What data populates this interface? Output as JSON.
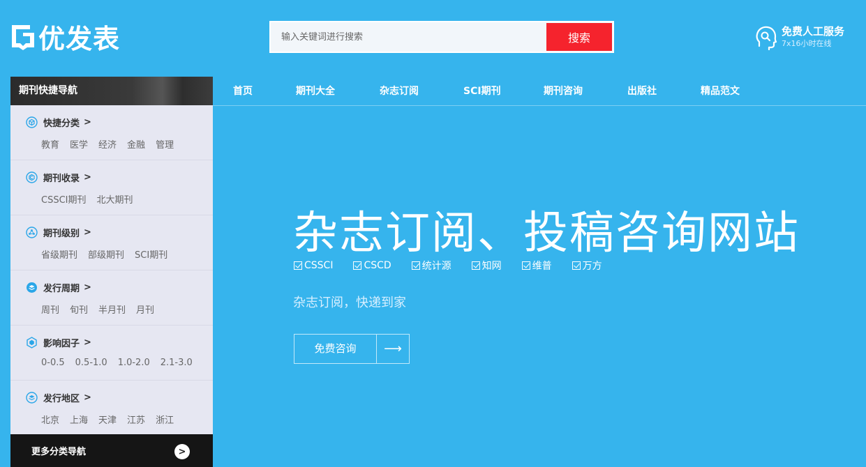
{
  "brand": {
    "name": "优发表"
  },
  "search": {
    "placeholder": "输入关键词进行搜索",
    "button_label": "搜索"
  },
  "service": {
    "title": "免费人工服务",
    "subtitle": "7x16小时在线",
    "icon": "headset-user-icon"
  },
  "nav": {
    "items": [
      {
        "label": "首页"
      },
      {
        "label": "期刊大全"
      },
      {
        "label": "杂志订阅"
      },
      {
        "label": "SCI期刊"
      },
      {
        "label": "期刊咨询"
      },
      {
        "label": "出版社"
      },
      {
        "label": "精品范文"
      }
    ]
  },
  "sidebar": {
    "heading": "期刊快捷导航",
    "categories": [
      {
        "title": "快捷分类",
        "arrow": ">",
        "links": [
          "教育",
          "医学",
          "经济",
          "金融",
          "管理"
        ]
      },
      {
        "title": "期刊收录",
        "arrow": ">",
        "links": [
          "CSSCI期刊",
          "北大期刊"
        ]
      },
      {
        "title": "期刊级别",
        "arrow": ">",
        "links": [
          "省级期刊",
          "部级期刊",
          "SCI期刊"
        ]
      },
      {
        "title": "发行周期",
        "arrow": ">",
        "links": [
          "周刊",
          "旬刊",
          "半月刊",
          "月刊"
        ]
      },
      {
        "title": "影响因子",
        "arrow": ">",
        "links": [
          "0-0.5",
          "0.5-1.0",
          "1.0-2.0",
          "2.1-3.0"
        ]
      },
      {
        "title": "发行地区",
        "arrow": ">",
        "links": [
          "北京",
          "上海",
          "天津",
          "江苏",
          "浙江"
        ]
      }
    ],
    "footer_label": "更多分类导航",
    "footer_button": ">"
  },
  "hero": {
    "title": "杂志订阅、投稿咨询网站",
    "checks": [
      "CSSCI",
      "CSCD",
      "统计源",
      "知网",
      "维普",
      "万方"
    ],
    "subtitle": "杂志订阅，快递到家",
    "cta_label": "免费咨询",
    "cta_arrow": "⟶"
  },
  "colors": {
    "background": "#36b4ed",
    "search_button": "#f5232d",
    "sidebar": "#e6e7f2",
    "sidebar_footer": "#151515",
    "icon_accent": "#2aa6e8"
  }
}
